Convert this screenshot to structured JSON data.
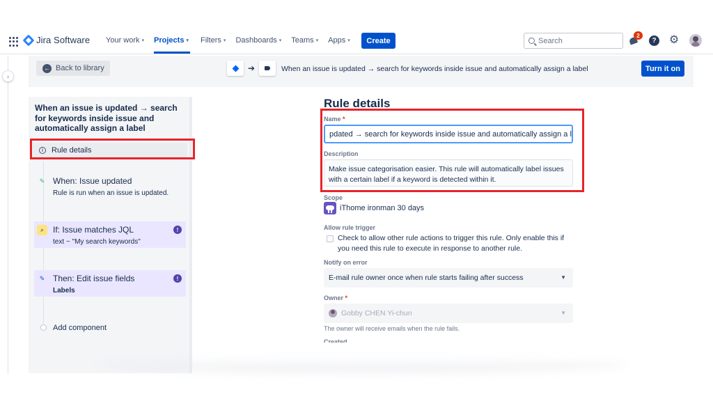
{
  "nav": {
    "brand": "Jira Software",
    "items": [
      {
        "label": "Your work"
      },
      {
        "label": "Projects"
      },
      {
        "label": "Filters"
      },
      {
        "label": "Dashboards"
      },
      {
        "label": "Teams"
      },
      {
        "label": "Apps"
      }
    ],
    "create_label": "Create",
    "search_placeholder": "Search",
    "notification_count": "2",
    "help_glyph": "?",
    "settings_glyph": "⚙"
  },
  "header": {
    "back_label": "Back to library",
    "rule_flow_title": "When an issue is updated → search for keywords inside issue and automatically assign a label",
    "turn_on_label": "Turn it on",
    "icons": [
      "diamond-trigger-icon",
      "arrow-right-icon",
      "tag-icon"
    ]
  },
  "sidebar": {
    "title": "When an issue is updated → search for keywords inside issue and automatically assign a label",
    "rule_details_label": "Rule details",
    "components": [
      {
        "title": "When: Issue updated",
        "subtitle": "Rule is run when an issue is updated.",
        "icon": "pencil-icon",
        "color": "#36b37e"
      },
      {
        "title": "If: Issue matches JQL",
        "subtitle": "text ~ \"My search keywords\"",
        "icon": "search-icon",
        "color": "#ffc400",
        "warning": "!"
      },
      {
        "title": "Then: Edit issue fields",
        "subtitle": "Labels",
        "icon": "pencil-icon",
        "color": "#0052cc",
        "warning": "!"
      }
    ],
    "add_component_label": "Add component"
  },
  "form": {
    "title": "Rule details",
    "name_label": "Name",
    "required_mark": "*",
    "name_value": "pdated → search for keywords inside issue and automatically assign a label",
    "description_label": "Description",
    "description_value": "Make issue categorisation easier. This rule will automatically label issues with a certain label if a keyword is detected within it.",
    "scope_label": "Scope",
    "scope_value": "iThome ironman 30 days",
    "allow_trigger_label": "Allow rule trigger",
    "allow_trigger_text": "Check to allow other rule actions to trigger this rule. Only enable this if you need this rule to execute in response to another rule.",
    "notify_label": "Notify on error",
    "notify_value": "E-mail rule owner once when rule starts failing after success",
    "owner_label": "Owner",
    "owner_value": "Gobby CHEN Yi-chun",
    "owner_helper": "The owner will receive emails when the rule fails.",
    "created_label": "Created"
  },
  "colors": {
    "brand": "#0052cc",
    "highlight": "#e6242b"
  }
}
